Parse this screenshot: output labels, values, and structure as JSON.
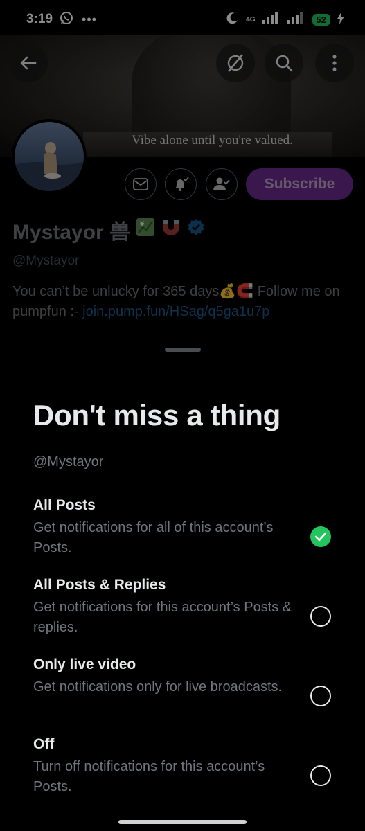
{
  "status_bar": {
    "time": "3:19",
    "network": "4G",
    "battery": "52"
  },
  "header": {
    "banner_text": "Vibe alone until you're valued.",
    "back_icon": "arrow-left-icon",
    "grok_icon": "grok-icon",
    "search_icon": "search-icon",
    "more_icon": "more-vertical-icon"
  },
  "profile": {
    "display_name": "Mystayor 兽",
    "handle": "@Mystayor",
    "bio_text": "You can’t be unlucky for 365 days💰🧲 Follow me on pumpfun :- ",
    "bio_link": "join.pump.fun/HSag/q5ga1u7p",
    "subscribe_label": "Subscribe",
    "verified_color": "#1d9bf0"
  },
  "sheet": {
    "title": "Don't miss a thing",
    "handle": "@Mystayor",
    "options": [
      {
        "title": "All Posts",
        "desc": "Get notifications for all of this account’s Posts.",
        "selected": true
      },
      {
        "title": "All Posts & Replies",
        "desc": "Get notifications for this account’s Posts & replies.",
        "selected": false
      },
      {
        "title": "Only live video",
        "desc": "Get notifications only for live broadcasts.",
        "selected": false
      },
      {
        "title": "Off",
        "desc": "Turn off notifications for this account’s Posts.",
        "selected": false
      }
    ]
  },
  "colors": {
    "accent_green": "#22c55e",
    "subscribe_purple": "#6b2a8a"
  }
}
